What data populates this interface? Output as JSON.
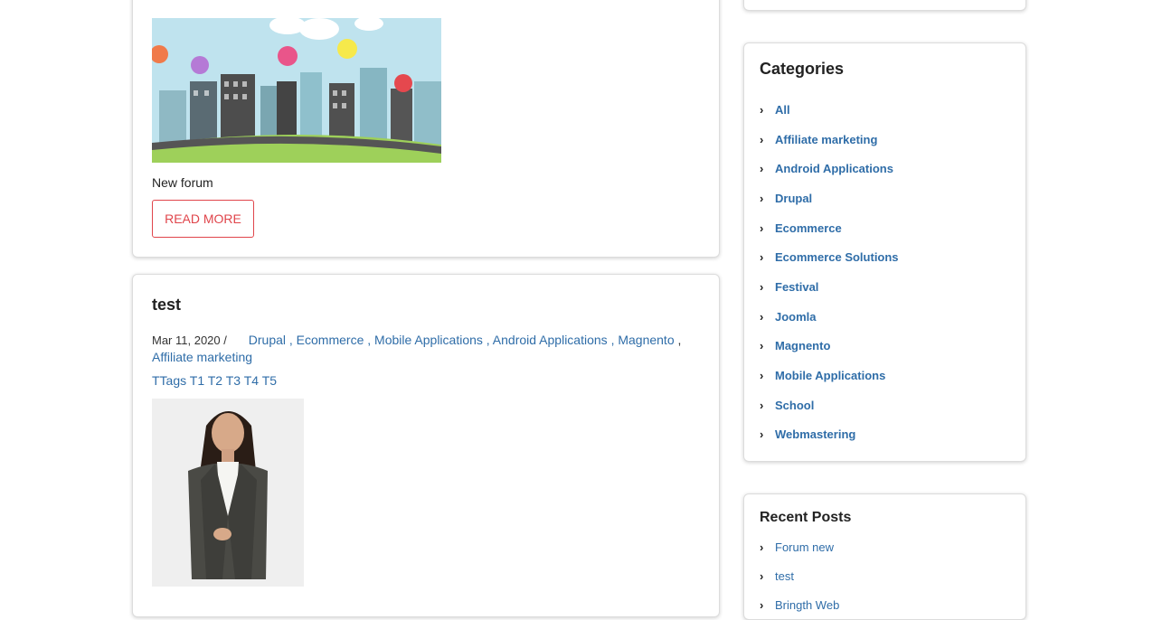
{
  "post_prev": {
    "snippet": "New forum",
    "read_more_label": "READ MORE"
  },
  "post_test": {
    "title": "test",
    "date": "Mar 11, 2020 /",
    "categories": [
      "Drupal",
      ", Ecommerce",
      ", Mobile Applications",
      ", Android Applications",
      ", Magnento",
      ",",
      "Affiliate marketing"
    ],
    "tags_label": "TTags",
    "tags": [
      "T1",
      "T2",
      "T3",
      "T4",
      "T5"
    ]
  },
  "sidebar": {
    "categories_heading": "Categories",
    "categories": [
      "All",
      "Affiliate marketing",
      "Android Applications",
      "Drupal",
      "Ecommerce",
      "Ecommerce Solutions",
      "Festival",
      "Joomla",
      "Magnento",
      "Mobile Applications",
      "School",
      "Webmastering"
    ],
    "recent_heading": "Recent Posts",
    "recent": [
      "Forum new",
      "test",
      "Bringth Web"
    ]
  },
  "colors": {
    "link": "#2f6da8",
    "accent": "#e0454b",
    "card_border": "#dcdcdc"
  }
}
